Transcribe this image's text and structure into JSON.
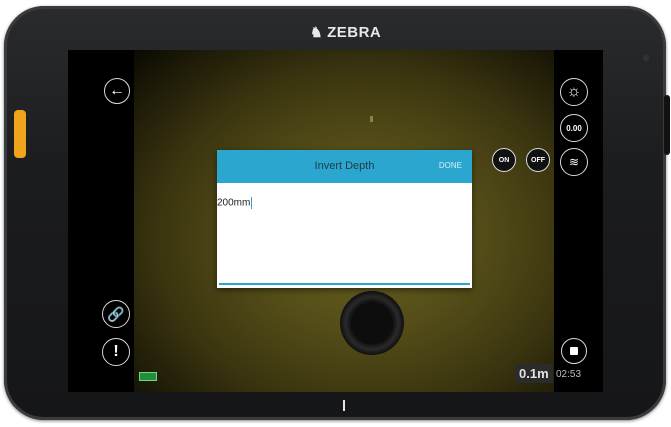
{
  "device": {
    "brand": "ZEBRA"
  },
  "camera_view": {
    "back_icon": "arrow-left-icon",
    "link_icon": "chain-link-icon",
    "alert_icon": "exclamation-icon",
    "alert_text": "!",
    "brightness_icon": "sun-icon",
    "zero_label": "0.00",
    "sonar_icon": "sonar-icon",
    "stop_icon": "stop-icon",
    "toggle_on_label": "ON",
    "toggle_off_label": "OFF",
    "battery_icon": "battery-icon",
    "distance": "0.1m",
    "timer": "02:53"
  },
  "dialog": {
    "title": "Invert Depth",
    "done_label": "DONE",
    "input_value": "200mm",
    "accent_color": "#2ba7cf"
  }
}
